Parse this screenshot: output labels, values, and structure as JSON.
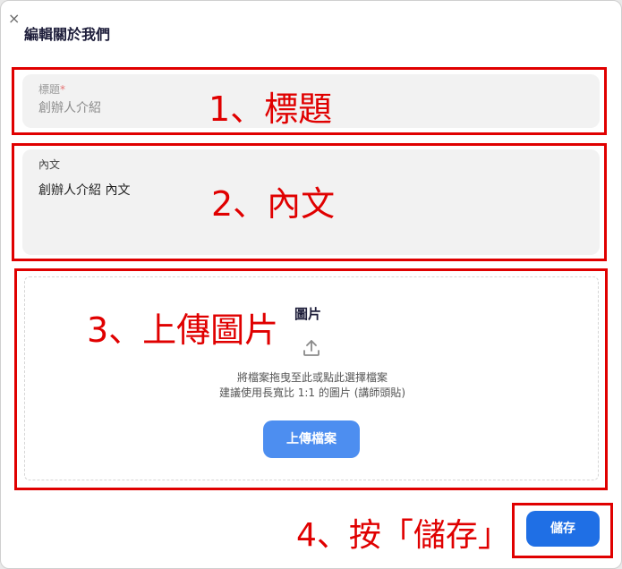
{
  "dialog": {
    "close_glyph": "×",
    "title": "編輯關於我們"
  },
  "title_field": {
    "label": "標題",
    "required_mark": "*",
    "value": "創辦人介紹"
  },
  "content_field": {
    "label": "內文",
    "value": "創辦人介紹 內文"
  },
  "image_section": {
    "heading": "圖片",
    "hint_line1": "將檔案拖曳至此或點此選擇檔案",
    "hint_line2": "建議使用長寬比 1:1 的圖片 (講師頭貼)",
    "upload_button_label": "上傳檔案",
    "upload_icon": "upload-icon"
  },
  "save_button_label": "儲存",
  "annotations": {
    "step1": "1、標題",
    "step2": "2、內文",
    "step3": "3、上傳圖片",
    "step4": "4、按「儲存」",
    "color": "#e00000"
  },
  "colors": {
    "save_button": "#1f6fe5",
    "upload_button": "#4d8ef0",
    "field_bg": "#f2f2f2"
  }
}
